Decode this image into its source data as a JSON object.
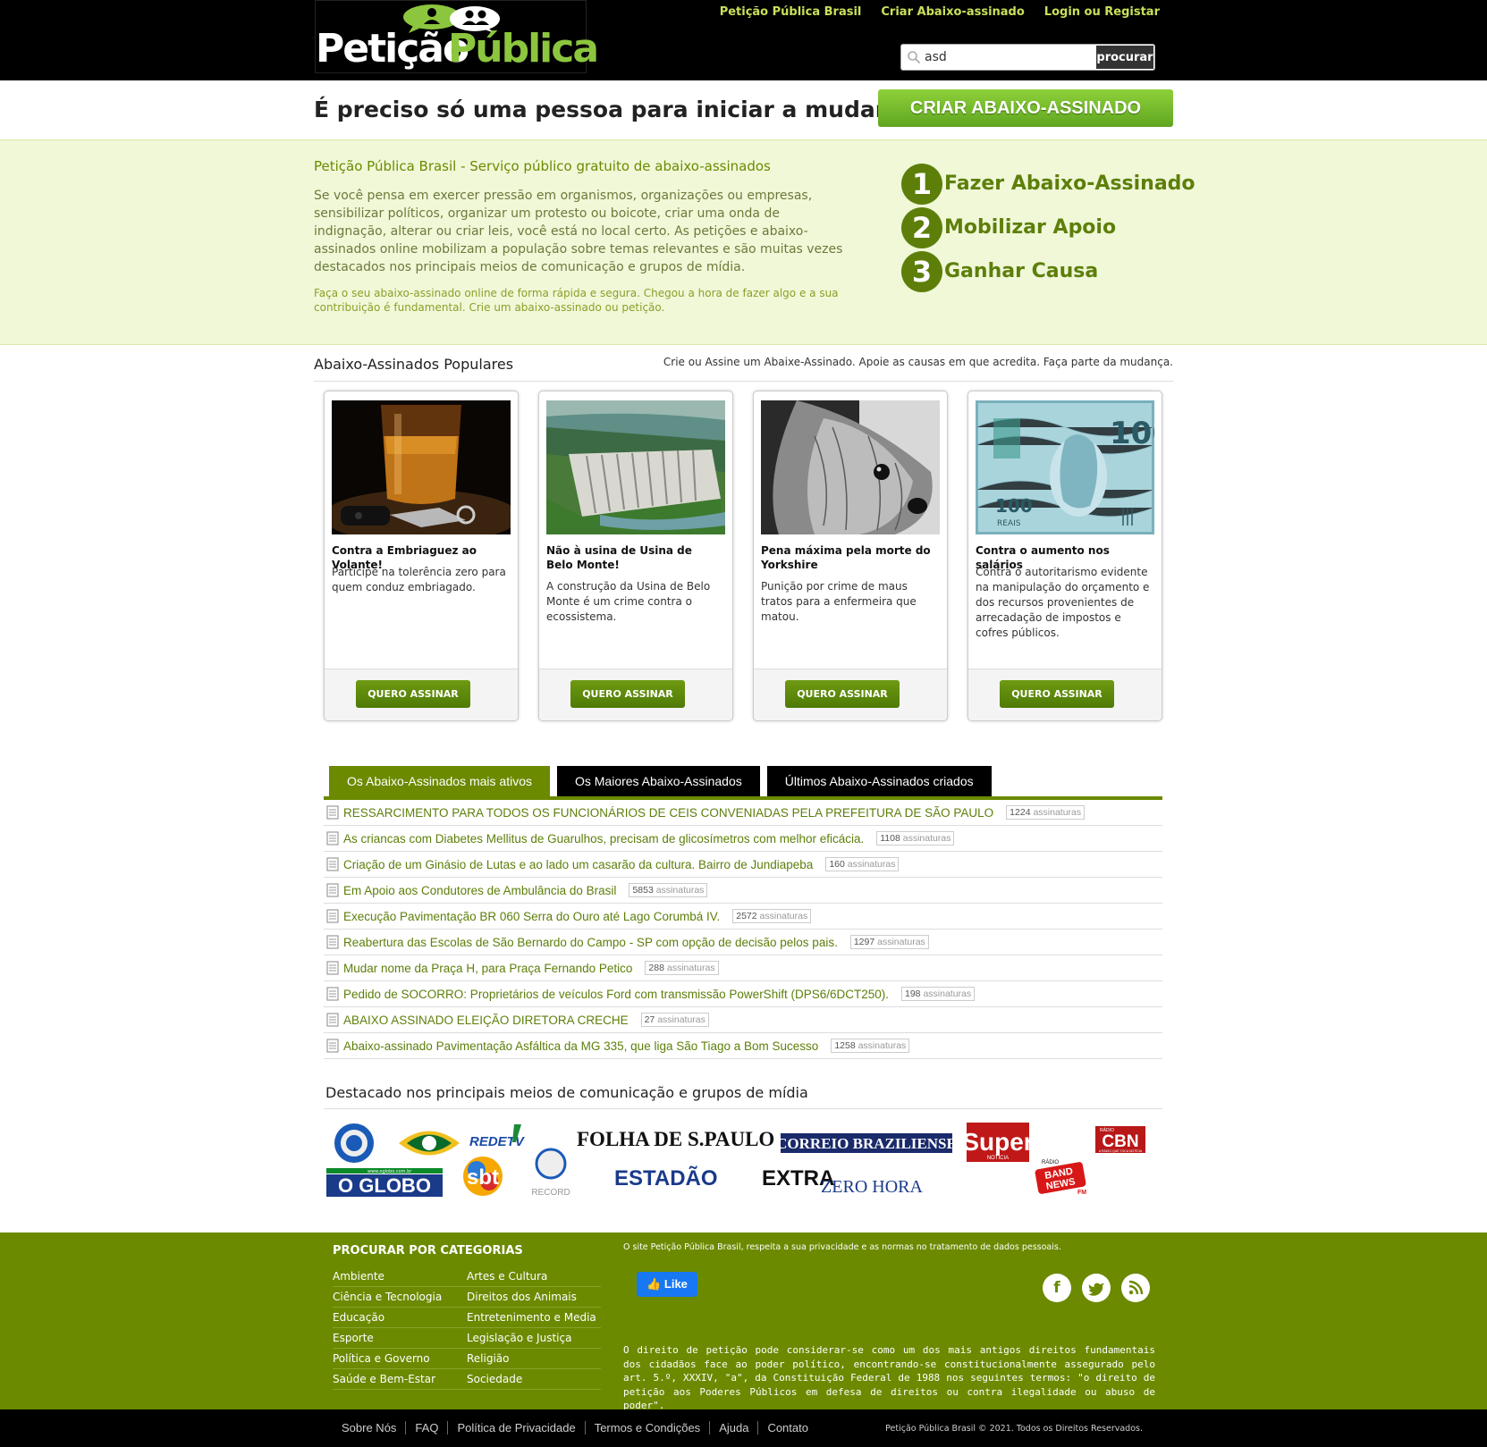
{
  "header": {
    "logo_part1": "Petição",
    "logo_part2": "Pública",
    "nav": [
      "Petição Pública Brasil",
      "Criar Abaixo-assinado",
      "Login ou Registar"
    ],
    "search_value": "asd",
    "search_button": "procurar"
  },
  "hero": {
    "tagline": "É preciso só uma pessoa para iniciar a mudança.",
    "cta": "CRIAR ABAIXO-ASSINADO"
  },
  "intro": {
    "title": "Petição Pública Brasil - Serviço público gratuito de abaixo-assinados",
    "body": "Se você pensa em exercer pressão em organismos, organizações ou empresas, sensibilizar políticos, organizar um protesto ou boicote, criar uma onda de indignação, alterar ou criar leis, você está no local certo. As petições e abaixo-assinados online mobilizam a população sobre temas relevantes e são muitas vezes destacados nos principais meios de comunicação e grupos de mídia.",
    "small": "Faça o seu abaixo-assinado online de forma rápida e segura. Chegou a hora de fazer algo e a sua contribuição é fundamental. Crie um abaixo-assinado ou petição.",
    "steps": [
      {
        "num": "1",
        "label": "Fazer Abaixo-Assinado"
      },
      {
        "num": "2",
        "label": "Mobilizar Apoio"
      },
      {
        "num": "3",
        "label": "Ganhar Causa"
      }
    ]
  },
  "popular": {
    "title": "Abaixo-Assinados Populares",
    "subtitle": "Crie ou Assine um Abaixe-Assinado. Apoie as causas em que acredita. Faça parte da mudança.",
    "cards": [
      {
        "title": "Contra a Embriaguez ao Volante!",
        "desc": "Participe na tolerência zero para quem conduz embriagado.",
        "button": "QUERO ASSINAR"
      },
      {
        "title": "Não à usina de Usina de Belo Monte!",
        "desc": "A construção da Usina de Belo Monte é um crime contra o ecossistema.",
        "button": "QUERO ASSINAR"
      },
      {
        "title": "Pena máxima pela morte do Yorkshire",
        "desc": "Punição por crime de maus tratos para a enfermeira que matou.",
        "button": "QUERO ASSINAR"
      },
      {
        "title": "Contra o aumento nos salários",
        "desc": "Contra o autoritarismo evidente na manipulação do orçamento e dos recursos provenientes de arrecadação de impostos e cofres públicos.",
        "button": "QUERO ASSINAR"
      }
    ],
    "banknote_value": "100",
    "banknote_word": "REAIS"
  },
  "tabs": [
    "Os Abaixo-Assinados mais ativos",
    "Os Maiores Abaixo-Assinados",
    "Últimos Abaixo-Assinados criados"
  ],
  "petitions": {
    "unit": "assinaturas",
    "items": [
      {
        "title": "RESSARCIMENTO PARA TODOS OS FUNCIONÁRIOS DE CEIS CONVENIADAS PELA PREFEITURA DE SÃO PAULO",
        "count": "1224"
      },
      {
        "title": "As criancas com Diabetes Mellitus de Guarulhos, precisam de glicosímetros com melhor eficácia.",
        "count": "1108"
      },
      {
        "title": "Criação de um Ginásio de Lutas e ao lado um casarão da cultura. Bairro de Jundiapeba",
        "count": "160"
      },
      {
        "title": "Em Apoio aos Condutores de Ambulância do Brasil",
        "count": "5853"
      },
      {
        "title": "Execução Pavimentação BR 060 Serra do Ouro até Lago Corumbá IV.",
        "count": "2572"
      },
      {
        "title": "Reabertura das Escolas de São Bernardo do Campo - SP com opção de decisão pelos pais.",
        "count": "1297"
      },
      {
        "title": "Mudar nome da Praça H, para Praça Fernando Petico",
        "count": "288"
      },
      {
        "title": "Pedido de SOCORRO: Proprietários de veículos Ford com transmissão PowerShift (DPS6/6DCT250).",
        "count": "198"
      },
      {
        "title": "ABAIXO ASSINADO ELEIÇÃO DIRETORA CRECHE",
        "count": "27"
      },
      {
        "title": "Abaixo-assinado Pavimentação Asfáltica da MG 335, que liga São Tiago a Bom Sucesso",
        "count": "1258"
      }
    ]
  },
  "media": {
    "title": "Destacado nos principais meios de comunicação e grupos de mídia",
    "logos": {
      "oglobo_url": "www.oglobo.com.br",
      "oglobo": "O GLOBO",
      "redetv": "REDETV",
      "sbt": "sbt",
      "record": "RECORD",
      "folha": "FOLHA DE S.PAULO",
      "estadao": "ESTADÃO",
      "correio": "CORREIO BRAZILIENSE",
      "extra": "EXTRA",
      "zerohora": "ZERO HORA",
      "super": "Super",
      "super_sub": "NOTÍCIA",
      "bandnews_top": "RÁDIO",
      "bandnews_a": "BAND",
      "bandnews_b": "NEWS",
      "bandnews_fm": "FM",
      "cbn_top": "RÁDIO",
      "cbn": "CBN",
      "cbn_sub": "A RÁDIO QUE TOCA NOTÍCIA"
    }
  },
  "footer": {
    "cats_title": "PROCURAR POR CATEGORIAS",
    "categories": [
      [
        "Ambiente",
        "Artes e Cultura"
      ],
      [
        "Ciência e Tecnologia",
        "Direitos dos Animais"
      ],
      [
        "Educação",
        "Entretenimento e Media"
      ],
      [
        "Esporte",
        "Legislação e Justiça"
      ],
      [
        "Política e Governo",
        "Religião"
      ],
      [
        "Saúde e Bem-Estar",
        "Sociedade"
      ]
    ],
    "privacy": "O site Petição Pública Brasil, respeita a sua privacidade e as normas no tratamento de dados pessoais.",
    "like": "Like",
    "law": "O direito de petição pode considerar-se como um dos mais antigos direitos fundamentais dos cidadãos face ao poder político, encontrando-se constitucionalmente assegurado pelo art. 5.º, XXXIV, \"a\", da Constituição Federal de 1988 nos seguintes termos: \"o direito de petição aos Poderes Públicos em defesa de direitos ou contra ilegalidade ou abuso de poder\".",
    "bottom_links": [
      "Sobre Nós",
      "FAQ",
      "Política de Privacidade",
      "Termos e Condições",
      "Ajuda",
      "Contato"
    ],
    "copyright": "Petição Pública Brasil © 2021. Todos os Direitos Reservados."
  },
  "colors": {
    "brand_green": "#6b8a00",
    "cta_green": "#7cc22e",
    "intro_bg": "#f0f8d8"
  },
  "icons": [
    "search-icon",
    "document-icon",
    "facebook-icon",
    "twitter-icon",
    "rss-icon",
    "thumbs-up-icon"
  ]
}
